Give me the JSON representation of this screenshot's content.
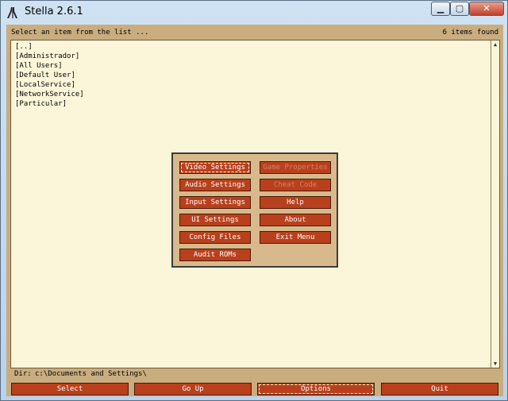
{
  "window": {
    "title": "Stella 2.6.1",
    "minimize_icon": "minimize-icon",
    "maximize_icon": "maximize-icon",
    "close_icon": "close-icon"
  },
  "header": {
    "prompt": "Select an item from the list ...",
    "count": "6 items found"
  },
  "file_list": {
    "items": [
      "[..]",
      "[Administrador]",
      "[All Users]",
      "[Default User]",
      "[LocalService]",
      "[NetworkService]",
      "[Particular]"
    ]
  },
  "options_dialog": {
    "buttons": [
      {
        "label": "Video Settings",
        "enabled": true,
        "focused": true
      },
      {
        "label": "Game Properties",
        "enabled": false
      },
      {
        "label": "Audio Settings",
        "enabled": true
      },
      {
        "label": "Cheat Code",
        "enabled": false
      },
      {
        "label": "Input Settings",
        "enabled": true
      },
      {
        "label": "Help",
        "enabled": true
      },
      {
        "label": "UI Settings",
        "enabled": true
      },
      {
        "label": "About",
        "enabled": true
      },
      {
        "label": "Config Files",
        "enabled": true
      },
      {
        "label": "Exit Menu",
        "enabled": true
      },
      {
        "label": "Audit ROMs",
        "enabled": true
      }
    ]
  },
  "footer": {
    "dir_label": "Dir:",
    "dir_value": "c:\\Documents and Settings\\",
    "select_label": "Select",
    "goup_label": "Go Up",
    "options_label": "Options",
    "quit_label": "Quit"
  },
  "colors": {
    "panel_bg": "#c9ad7f",
    "list_bg": "#fbf6d9",
    "button_bg": "#b8401d",
    "dialog_bg": "#d8b98b"
  }
}
